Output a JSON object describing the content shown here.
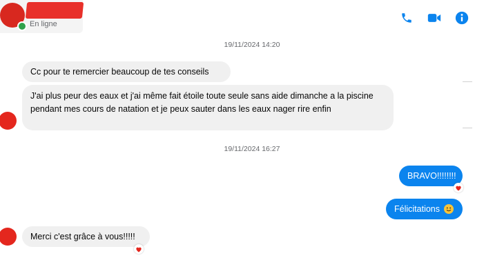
{
  "header": {
    "status": "En ligne",
    "icons": [
      "phone-icon",
      "video-camera-icon",
      "info-icon"
    ]
  },
  "colors": {
    "accent": "#0b84ee",
    "incoming_bubble": "#f0f0f0",
    "redaction": "#e4271e",
    "online": "#31a24c"
  },
  "messages": {
    "timestamp_1": "19/11/2024 14:20",
    "in_1": "Cc pour te remercier beaucoup de tes conseils",
    "in_2": "J'ai plus peur des eaux et j'ai même fait étoile toute seule sans aide   dimanche a la piscine pendant mes cours de natation et je peux sauter dans les eaux nager rire enfin",
    "timestamp_2": "19/11/2024 16:27",
    "out_1": "BRAVO!!!!!!!!",
    "out_2": "Félicitations",
    "in_3": "Merci c'est grâce à vous!!!!!"
  },
  "reactions": {
    "out_1": "heart-icon",
    "out_2": "smile-emoji-icon",
    "in_3": "heart-icon"
  }
}
